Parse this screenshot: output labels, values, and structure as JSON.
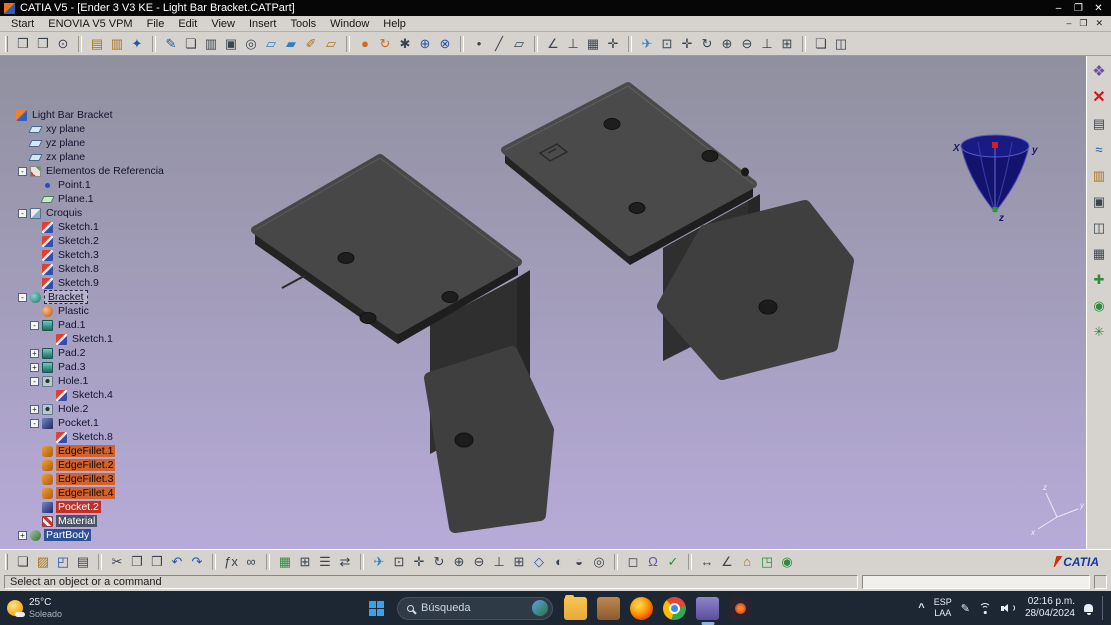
{
  "titlebar": {
    "title": "CATIA V5 - [Ender 3 V3 KE - Light Bar Bracket.CATPart]"
  },
  "window_controls": {
    "minimize": "–",
    "maximize": "❐",
    "close": "✕"
  },
  "menubar": {
    "items": [
      "Start",
      "ENOVIA V5 VPM",
      "File",
      "Edit",
      "View",
      "Insert",
      "Tools",
      "Window",
      "Help"
    ]
  },
  "colors": {
    "viewport_top": "#90909f",
    "viewport_bottom": "#b7abd9",
    "part_gray": "#474747",
    "selection_orange": "#d2622e",
    "selection_red": "#c03026",
    "selection_blue": "#2f4f94",
    "toolbar_bg": "#d6d3ce",
    "titlebar_bg": "#060606",
    "taskbar_bg": "#1d2633",
    "compass_blue": "#13136e"
  },
  "top_toolbar": {
    "icons": [
      {
        "name": "paste-special-icon",
        "glyph": "❒",
        "tone": "slate"
      },
      {
        "name": "clipboard-icon",
        "glyph": "❐",
        "tone": "slate"
      },
      {
        "name": "magnifier-icon",
        "glyph": "⊙",
        "tone": "slate"
      },
      {
        "name": "catalog-icon",
        "glyph": "▤",
        "tone": "amber",
        "sep": "true"
      },
      {
        "name": "library-icon",
        "glyph": "▥",
        "tone": "amber"
      },
      {
        "name": "favorites-icon",
        "glyph": "✦",
        "tone": "blue"
      },
      {
        "name": "sketcher-icon",
        "glyph": "✎",
        "tone": "blue",
        "sep": "true"
      },
      {
        "name": "view-frame-icon",
        "glyph": "❏",
        "tone": "slate"
      },
      {
        "name": "columns-icon",
        "glyph": "▥",
        "tone": "slate"
      },
      {
        "name": "part-box-icon",
        "glyph": "▣",
        "tone": "slate"
      },
      {
        "name": "circle-tool-icon",
        "glyph": "◎",
        "tone": "slate"
      },
      {
        "name": "plane-offset-icon",
        "glyph": "▱",
        "tone": "sky"
      },
      {
        "name": "plane-angle-icon",
        "glyph": "▰",
        "tone": "sky"
      },
      {
        "name": "sketch-plane-icon",
        "glyph": "✐",
        "tone": "amber"
      },
      {
        "name": "surface-plane-icon",
        "glyph": "▱",
        "tone": "amber"
      },
      {
        "name": "sphere-icon",
        "glyph": "●",
        "tone": "orange",
        "sep": "true"
      },
      {
        "name": "revolve-icon",
        "glyph": "↻",
        "tone": "orange"
      },
      {
        "name": "gear-icon",
        "glyph": "✱",
        "tone": "slate"
      },
      {
        "name": "union-icon",
        "glyph": "⊕",
        "tone": "blue"
      },
      {
        "name": "intersect-icon",
        "glyph": "⊗",
        "tone": "blue"
      },
      {
        "name": "point-icon",
        "glyph": "•",
        "tone": "slate",
        "sep": "true"
      },
      {
        "name": "line-icon",
        "glyph": "╱",
        "tone": "slate"
      },
      {
        "name": "plane-icon",
        "glyph": "▱",
        "tone": "slate"
      },
      {
        "name": "measure-icon",
        "glyph": "∠",
        "tone": "slate",
        "sep": "true"
      },
      {
        "name": "constraints-icon",
        "glyph": "⊥",
        "tone": "slate"
      },
      {
        "name": "grid-icon",
        "glyph": "▦",
        "tone": "slate"
      },
      {
        "name": "axis-system-icon",
        "glyph": "✛",
        "tone": "slate"
      },
      {
        "name": "fly-mode-icon",
        "glyph": "✈",
        "tone": "sky",
        "sep": "true"
      },
      {
        "name": "fit-all-icon",
        "glyph": "⊡",
        "tone": "slate"
      },
      {
        "name": "pan-icon",
        "glyph": "✛",
        "tone": "slate"
      },
      {
        "name": "rotate-icon",
        "glyph": "↻",
        "tone": "slate"
      },
      {
        "name": "zoom-in-icon",
        "glyph": "⊕",
        "tone": "slate"
      },
      {
        "name": "zoom-out-icon",
        "glyph": "⊖",
        "tone": "slate"
      },
      {
        "name": "normal-view-icon",
        "glyph": "⊥",
        "tone": "slate"
      },
      {
        "name": "multi-view-icon",
        "glyph": "⊞",
        "tone": "slate"
      },
      {
        "name": "new-window-icon",
        "glyph": "❏",
        "tone": "slate",
        "sep": "true"
      },
      {
        "name": "tile-windows-icon",
        "glyph": "◫",
        "tone": "slate"
      }
    ]
  },
  "tree": {
    "items": [
      {
        "label": "Light Bar Bracket",
        "indent": 0,
        "icon": "part"
      },
      {
        "label": "xy plane",
        "indent": 1,
        "icon": "plane"
      },
      {
        "label": "yz plane",
        "indent": 1,
        "icon": "plane"
      },
      {
        "label": "zx plane",
        "indent": 1,
        "icon": "plane"
      },
      {
        "label": "Elementos de Referencia",
        "indent": 1,
        "icon": "refset",
        "exp": "-"
      },
      {
        "label": "Point.1",
        "indent": 2,
        "icon": "point"
      },
      {
        "label": "Plane.1",
        "indent": 2,
        "icon": "plane2"
      },
      {
        "label": "Croquis",
        "indent": 1,
        "icon": "sketchset",
        "exp": "-"
      },
      {
        "label": "Sketch.1",
        "indent": 2,
        "icon": "sketch"
      },
      {
        "label": "Sketch.2",
        "indent": 2,
        "icon": "sketch"
      },
      {
        "label": "Sketch.3",
        "indent": 2,
        "icon": "sketch"
      },
      {
        "label": "Sketch.8",
        "indent": 2,
        "icon": "sketch"
      },
      {
        "label": "Sketch.9",
        "indent": 2,
        "icon": "sketch"
      },
      {
        "label": "Bracket",
        "indent": 1,
        "icon": "body",
        "exp": "-",
        "hl": "active"
      },
      {
        "label": "Plastic",
        "indent": 2,
        "icon": "material"
      },
      {
        "label": "Pad.1",
        "indent": 2,
        "icon": "pad",
        "exp": "-"
      },
      {
        "label": "Sketch.1",
        "indent": 3,
        "icon": "sketch"
      },
      {
        "label": "Pad.2",
        "indent": 2,
        "icon": "pad",
        "exp": "+"
      },
      {
        "label": "Pad.3",
        "indent": 2,
        "icon": "pad",
        "exp": "+"
      },
      {
        "label": "Hole.1",
        "indent": 2,
        "icon": "hole",
        "exp": "-"
      },
      {
        "label": "Sketch.4",
        "indent": 3,
        "icon": "sketch"
      },
      {
        "label": "Hole.2",
        "indent": 2,
        "icon": "hole",
        "exp": "+"
      },
      {
        "label": "Pocket.1",
        "indent": 2,
        "icon": "pocket",
        "exp": "-"
      },
      {
        "label": "Sketch.8",
        "indent": 3,
        "icon": "sketch"
      },
      {
        "label": "EdgeFillet.1",
        "indent": 2,
        "icon": "fillet",
        "hl": "orange"
      },
      {
        "label": "EdgeFillet.2",
        "indent": 2,
        "icon": "fillet",
        "hl": "orange"
      },
      {
        "label": "EdgeFillet.3",
        "indent": 2,
        "icon": "fillet",
        "hl": "orange"
      },
      {
        "label": "EdgeFillet.4",
        "indent": 2,
        "icon": "fillet",
        "hl": "orange"
      },
      {
        "label": "Pocket.2",
        "indent": 2,
        "icon": "pocket",
        "hl": "red"
      },
      {
        "label": "Material",
        "indent": 2,
        "icon": "materialdef",
        "hl": "dark"
      },
      {
        "label": "PartBody",
        "indent": 1,
        "icon": "partbody",
        "exp": "+",
        "hl": "blue"
      }
    ]
  },
  "compass": {
    "x": "X",
    "y": "y",
    "z": "z"
  },
  "axis_triad": {
    "x": "x",
    "y": "y",
    "z": "z"
  },
  "right_toolbar": {
    "icons": [
      {
        "name": "workbench-icon",
        "glyph": "❖",
        "tone": "purple"
      },
      {
        "name": "close-workbench-icon",
        "glyph": "✕",
        "tone": "red"
      },
      {
        "name": "notes-icon",
        "glyph": "▤",
        "tone": "slate"
      },
      {
        "name": "graph-icon",
        "glyph": "≈",
        "tone": "blue"
      },
      {
        "name": "layers-icon",
        "glyph": "▥",
        "tone": "amber"
      },
      {
        "name": "box-icon",
        "glyph": "▣",
        "tone": "slate"
      },
      {
        "name": "cylinder-icon",
        "glyph": "◫",
        "tone": "slate"
      },
      {
        "name": "table-icon",
        "glyph": "▦",
        "tone": "slate"
      },
      {
        "name": "tools-icon",
        "glyph": "✚",
        "tone": "green"
      },
      {
        "name": "globe-icon",
        "glyph": "◉",
        "tone": "green"
      },
      {
        "name": "molecule-icon",
        "glyph": "✳",
        "tone": "green"
      }
    ]
  },
  "bottom_toolbar": {
    "brand": "CATIA",
    "icons": [
      {
        "name": "new-document-icon",
        "glyph": "❏",
        "tone": "slate"
      },
      {
        "name": "open-icon",
        "glyph": "▨",
        "tone": "amber"
      },
      {
        "name": "save-icon",
        "glyph": "◰",
        "tone": "blue"
      },
      {
        "name": "print-icon",
        "glyph": "▤",
        "tone": "slate"
      },
      {
        "name": "cut-icon",
        "glyph": "✂",
        "tone": "slate",
        "sep": "true"
      },
      {
        "name": "copy-icon",
        "glyph": "❐",
        "tone": "slate"
      },
      {
        "name": "paste-icon",
        "glyph": "❒",
        "tone": "slate"
      },
      {
        "name": "undo-icon",
        "glyph": "↶",
        "tone": "blue"
      },
      {
        "name": "redo-icon",
        "glyph": "↷",
        "tone": "blue"
      },
      {
        "name": "formula-icon",
        "glyph": "ƒx",
        "tone": "slate",
        "sep": "true"
      },
      {
        "name": "search-icon",
        "glyph": "∞",
        "tone": "slate"
      },
      {
        "name": "grid-icon",
        "glyph": "▦",
        "tone": "green",
        "sep": "true"
      },
      {
        "name": "snap-icon",
        "glyph": "⊞",
        "tone": "slate"
      },
      {
        "name": "structure-icon",
        "glyph": "☰",
        "tone": "slate"
      },
      {
        "name": "swap-icon",
        "glyph": "⇄",
        "tone": "slate"
      },
      {
        "name": "fly-mode-icon",
        "glyph": "✈",
        "tone": "sky",
        "sep": "true"
      },
      {
        "name": "fit-all-icon",
        "glyph": "⊡",
        "tone": "slate"
      },
      {
        "name": "pan-icon",
        "glyph": "✛",
        "tone": "slate"
      },
      {
        "name": "rotate-icon",
        "glyph": "↻",
        "tone": "slate"
      },
      {
        "name": "zoom-in-icon",
        "glyph": "⊕",
        "tone": "slate"
      },
      {
        "name": "zoom-out-icon",
        "glyph": "⊖",
        "tone": "slate"
      },
      {
        "name": "normal-view-icon",
        "glyph": "⊥",
        "tone": "slate"
      },
      {
        "name": "multi-view-icon",
        "glyph": "⊞",
        "tone": "slate"
      },
      {
        "name": "iso-view-icon",
        "glyph": "◇",
        "tone": "blue"
      },
      {
        "name": "shaded-view-icon",
        "glyph": "◐",
        "tone": "slate"
      },
      {
        "name": "hide-show-icon",
        "glyph": "◒",
        "tone": "slate"
      },
      {
        "name": "swap-space-icon",
        "glyph": "◎",
        "tone": "slate"
      },
      {
        "name": "wireframe-icon",
        "glyph": "◻",
        "tone": "slate",
        "sep": "true"
      },
      {
        "name": "knowledge-icon",
        "glyph": "Ω",
        "tone": "purple"
      },
      {
        "name": "check-icon",
        "glyph": "✓",
        "tone": "green"
      },
      {
        "name": "measure-between-icon",
        "glyph": "↔",
        "tone": "slate",
        "sep": "true"
      },
      {
        "name": "measure-item-icon",
        "glyph": "∠",
        "tone": "slate"
      },
      {
        "name": "measure-inertia-icon",
        "glyph": "⌂",
        "tone": "amber"
      },
      {
        "name": "apply-material-icon",
        "glyph": "◳",
        "tone": "green"
      },
      {
        "name": "render-icon",
        "glyph": "◉",
        "tone": "green"
      }
    ]
  },
  "statusbar": {
    "message": "Select an object or a command",
    "power_input_value": ""
  },
  "taskbar": {
    "weather_temp": "25°C",
    "weather_desc": "Soleado",
    "search_placeholder": "Búsqueda",
    "apps": [
      {
        "name": "folder-icon",
        "app": "folder"
      },
      {
        "name": "archive-icon",
        "app": "archive"
      },
      {
        "name": "firefox-icon",
        "app": "firefox"
      },
      {
        "name": "chrome-icon",
        "app": "chrome"
      },
      {
        "name": "catia-taskbar-icon",
        "app": "catia",
        "active": true
      },
      {
        "name": "media-player-icon",
        "app": "media"
      }
    ],
    "tray": {
      "chevron": "^",
      "lang_line1": "ESP",
      "lang_line2": "LAA",
      "pen_glyph": "✎",
      "time": "02:16 p.m.",
      "date": "28/04/2024"
    }
  }
}
